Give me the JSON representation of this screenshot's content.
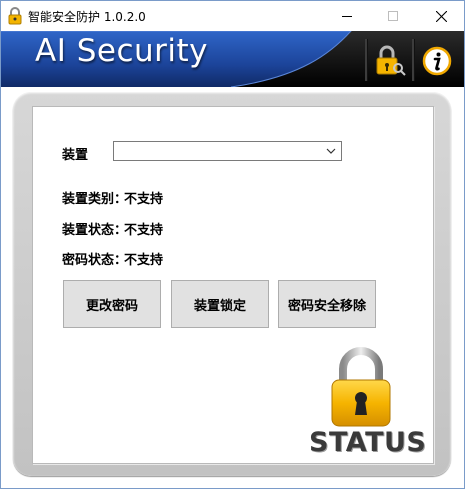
{
  "window": {
    "title": "智能安全防护 1.0.2.0"
  },
  "banner": {
    "title": "AI Security",
    "icons": [
      "lock-key-icon",
      "info-icon"
    ]
  },
  "device": {
    "label": "装置",
    "selected_value": ""
  },
  "info": {
    "type_label": "装置类别：",
    "type_value": "不支持",
    "state_label": "装置状态：",
    "state_value": "不支持",
    "password_label": "密码状态：",
    "password_value": "不支持"
  },
  "buttons": {
    "change_password": "更改密码",
    "lock_device": "装置锁定",
    "remove_password": "密码安全移除"
  },
  "status": {
    "label": "STATUS",
    "state": "locked"
  },
  "colors": {
    "banner_blue": "#1f4fa8",
    "banner_black": "#000000",
    "lock_gold": "#f5b800"
  }
}
